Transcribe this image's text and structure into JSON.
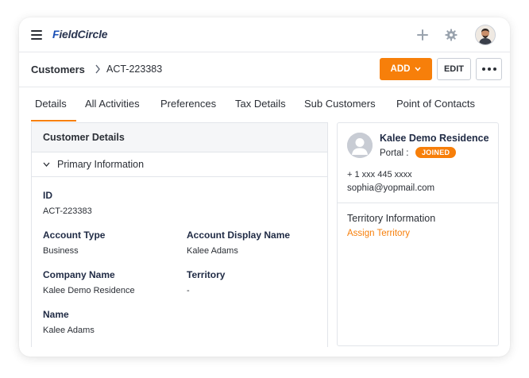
{
  "app": {
    "logo_first": "F",
    "logo_rest": "ieldCircle",
    "accent_color": "#f77f0a",
    "brand_color": "#1a4fb5"
  },
  "topbar": {
    "icons": [
      "menu-icon",
      "plus-icon",
      "gear-icon",
      "user-avatar"
    ]
  },
  "breadcrumb": {
    "root": "Customers",
    "current": "ACT-223383"
  },
  "actions": {
    "add_label": "ADD",
    "edit_label": "EDIT"
  },
  "tabs": [
    {
      "label": "Details",
      "active": true
    },
    {
      "label": "All Activities",
      "active": false
    },
    {
      "label": "Preferences",
      "active": false
    },
    {
      "label": "Tax Details",
      "active": false
    },
    {
      "label": "Sub Customers",
      "active": false
    },
    {
      "label": "Point of Contacts",
      "active": false
    }
  ],
  "customer_details": {
    "title": "Customer Details",
    "section": "Primary Information",
    "fields": {
      "id": {
        "label": "ID",
        "value": "ACT-223383"
      },
      "account_type": {
        "label": "Account Type",
        "value": "Business"
      },
      "account_display_name": {
        "label": "Account Display Name",
        "value": "Kalee Adams"
      },
      "company_name": {
        "label": "Company Name",
        "value": "Kalee Demo Residence"
      },
      "territory": {
        "label": "Territory",
        "value": "-"
      },
      "name": {
        "label": "Name",
        "value": "Kalee Adams"
      }
    }
  },
  "contact_card": {
    "name": "Kalee Demo Residence",
    "portal_label": "Portal :",
    "portal_status": "JOINED",
    "phone": "+ 1 xxx 445 xxxx",
    "email": "sophia@yopmail.com",
    "territory_title": "Territory Information",
    "assign_link": "Assign Territory"
  }
}
